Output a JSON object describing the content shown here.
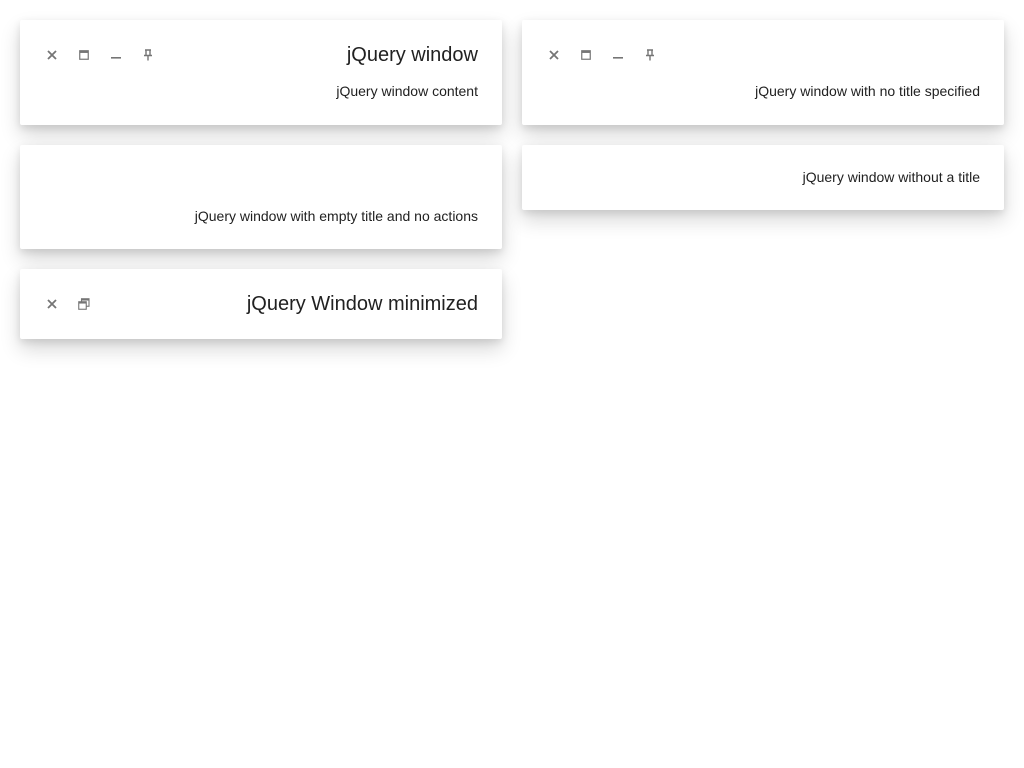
{
  "windows": [
    {
      "title": "jQuery window",
      "content": "jQuery window content",
      "actions": [
        "close-icon",
        "maximize-icon",
        "minimize-icon",
        "pin-icon"
      ]
    },
    {
      "title": "",
      "content": "jQuery window with no title specified",
      "actions": [
        "close-icon",
        "maximize-icon",
        "minimize-icon",
        "pin-icon"
      ]
    },
    {
      "title": "",
      "content": "jQuery window with empty title and no actions",
      "actions": []
    },
    {
      "title": "",
      "content": "jQuery window without a title",
      "actions": []
    },
    {
      "title": "jQuery Window minimized",
      "content": "",
      "actions": [
        "close-icon",
        "restore-icon"
      ],
      "state": "minimized"
    }
  ],
  "colors": {
    "icon": "#757575",
    "text": "#212121",
    "background": "#ffffff"
  }
}
